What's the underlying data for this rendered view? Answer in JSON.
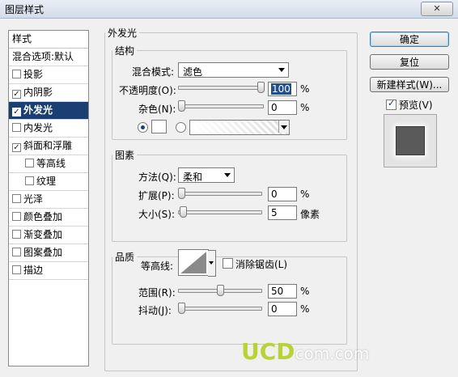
{
  "window": {
    "title": "图层样式",
    "close_icon": "close-icon"
  },
  "style_list": {
    "header": "样式",
    "items": [
      {
        "label": "混合选项:默认",
        "checkbox": false,
        "checked": false,
        "sub": false,
        "selected": false
      },
      {
        "label": "投影",
        "checkbox": true,
        "checked": false,
        "sub": false,
        "selected": false
      },
      {
        "label": "内阴影",
        "checkbox": true,
        "checked": true,
        "sub": false,
        "selected": false
      },
      {
        "label": "外发光",
        "checkbox": true,
        "checked": true,
        "sub": false,
        "selected": true
      },
      {
        "label": "内发光",
        "checkbox": true,
        "checked": false,
        "sub": false,
        "selected": false
      },
      {
        "label": "斜面和浮雕",
        "checkbox": true,
        "checked": true,
        "sub": false,
        "selected": false
      },
      {
        "label": "等高线",
        "checkbox": true,
        "checked": false,
        "sub": true,
        "selected": false
      },
      {
        "label": "纹理",
        "checkbox": true,
        "checked": false,
        "sub": true,
        "selected": false
      },
      {
        "label": "光泽",
        "checkbox": true,
        "checked": false,
        "sub": false,
        "selected": false
      },
      {
        "label": "颜色叠加",
        "checkbox": true,
        "checked": false,
        "sub": false,
        "selected": false
      },
      {
        "label": "渐变叠加",
        "checkbox": true,
        "checked": false,
        "sub": false,
        "selected": false
      },
      {
        "label": "图案叠加",
        "checkbox": true,
        "checked": false,
        "sub": false,
        "selected": false
      },
      {
        "label": "描边",
        "checkbox": true,
        "checked": false,
        "sub": false,
        "selected": false
      }
    ]
  },
  "panel": {
    "title": "外发光",
    "structure": {
      "title": "结构",
      "blend_mode_label": "混合模式:",
      "blend_mode_value": "滤色",
      "opacity_label": "不透明度(O):",
      "opacity_value": "100",
      "opacity_unit": "%",
      "opacity_level": 1.0,
      "noise_label": "杂色(N):",
      "noise_value": "0",
      "noise_unit": "%",
      "noise_level": 0.0
    },
    "elements": {
      "title": "图素",
      "method_label": "方法(Q):",
      "method_value": "柔和",
      "spread_label": "扩展(P):",
      "spread_value": "0",
      "spread_unit": "%",
      "spread_level": 0.0,
      "size_label": "大小(S):",
      "size_value": "5",
      "size_unit": "像素",
      "size_level": 0.02
    },
    "quality": {
      "title": "品质",
      "contour_label": "等高线:",
      "antialias_label": "消除锯齿(L)",
      "antialias_checked": false,
      "range_label": "范围(R):",
      "range_value": "50",
      "range_unit": "%",
      "range_level": 0.5,
      "jitter_label": "抖动(J):",
      "jitter_value": "0",
      "jitter_unit": "%",
      "jitter_level": 0.0
    }
  },
  "buttons": {
    "ok": "确定",
    "reset": "复位",
    "new_style": "新建样式(W)...",
    "preview_label": "预览(V)",
    "preview_checked": true
  },
  "watermark": {
    "logo": "UCD",
    "suffix": "com.com"
  }
}
